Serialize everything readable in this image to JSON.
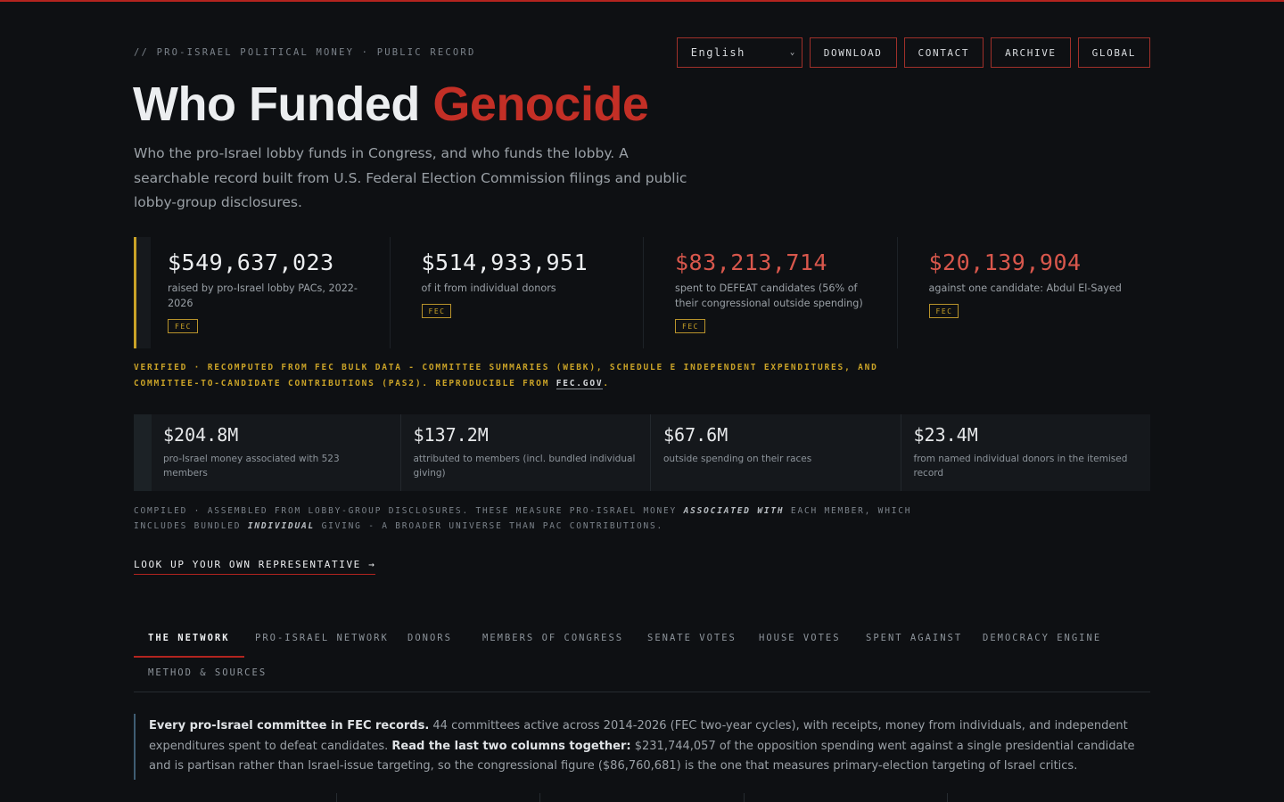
{
  "header": {
    "kicker": "// PRO-ISRAEL POLITICAL MONEY · PUBLIC RECORD",
    "language": "English",
    "nav": [
      "DOWNLOAD",
      "CONTACT",
      "ARCHIVE",
      "GLOBAL"
    ]
  },
  "hero": {
    "title_main": "Who Funded ",
    "title_accent": "Genocide",
    "intro": "Who the pro-Israel lobby funds in Congress, and who funds the lobby. A searchable record built from U.S. Federal Election Commission filings and public lobby-group disclosures."
  },
  "stats_fec": [
    {
      "value": "$549,637,023",
      "desc": "raised by pro-Israel lobby PACs, 2022-2026",
      "badge": "FEC"
    },
    {
      "value": "$514,933,951",
      "desc": "of it from individual donors",
      "badge": "FEC"
    },
    {
      "value": "$83,213,714",
      "desc": "spent to DEFEAT candidates (56% of their congressional outside spending)",
      "badge": "FEC"
    },
    {
      "value": "$20,139,904",
      "desc": "against one candidate: Abdul El-Sayed",
      "badge": "FEC"
    }
  ],
  "verified": {
    "text": "VERIFIED · RECOMPUTED FROM FEC BULK DATA - COMMITTEE SUMMARIES (WEBK), SCHEDULE E INDEPENDENT EXPENDITURES, AND COMMITTEE-TO-CANDIDATE CONTRIBUTIONS (PAS2). REPRODUCIBLE FROM ",
    "link": "FEC.GOV",
    "end": "."
  },
  "stats_compiled": [
    {
      "value": "$204.8M",
      "desc": "pro-Israel money associated with 523 members"
    },
    {
      "value": "$137.2M",
      "desc": "attributed to members (incl. bundled individual giving)"
    },
    {
      "value": "$67.6M",
      "desc": "outside spending on their races"
    },
    {
      "value": "$23.4M",
      "desc": "from named individual donors in the itemised record"
    }
  ],
  "compiled": {
    "a": "COMPILED · ASSEMBLED FROM LOBBY-GROUP DISCLOSURES. THESE MEASURE PRO-ISRAEL MONEY ",
    "em1": "ASSOCIATED WITH",
    "b": " EACH MEMBER, WHICH INCLUDES BUNDLED ",
    "em2": "INDIVIDUAL",
    "c": " GIVING - A BROADER UNIVERSE THAN PAC CONTRIBUTIONS."
  },
  "lookup": "LOOK UP YOUR OWN REPRESENTATIVE →",
  "tabs": [
    "THE NETWORK",
    "PRO-ISRAEL NETWORK",
    "DONORS",
    "MEMBERS OF CONGRESS",
    "SENATE VOTES",
    "HOUSE VOTES",
    "SPENT AGAINST",
    "DEMOCRACY ENGINE",
    "METHOD & SOURCES"
  ],
  "active_tab": "THE NETWORK",
  "note": {
    "b1": "Every pro-Israel committee in FEC records.",
    "t1": " 44 committees active across 2014-2026 (FEC two-year cycles), with receipts, money from individuals, and independent expenditures spent to defeat candidates. ",
    "b2": "Read the last two columns together:",
    "t2": " $231,744,057 of the opposition spending went against a single presidential candidate and is partisan rather than Israel-issue targeting, so the congressional figure ($86,760,681) is the one that measures primary-election targeting of Israel critics."
  },
  "colors": {
    "accent_red": "#c32f26",
    "gold": "#c9a227",
    "background": "#0e1013"
  }
}
